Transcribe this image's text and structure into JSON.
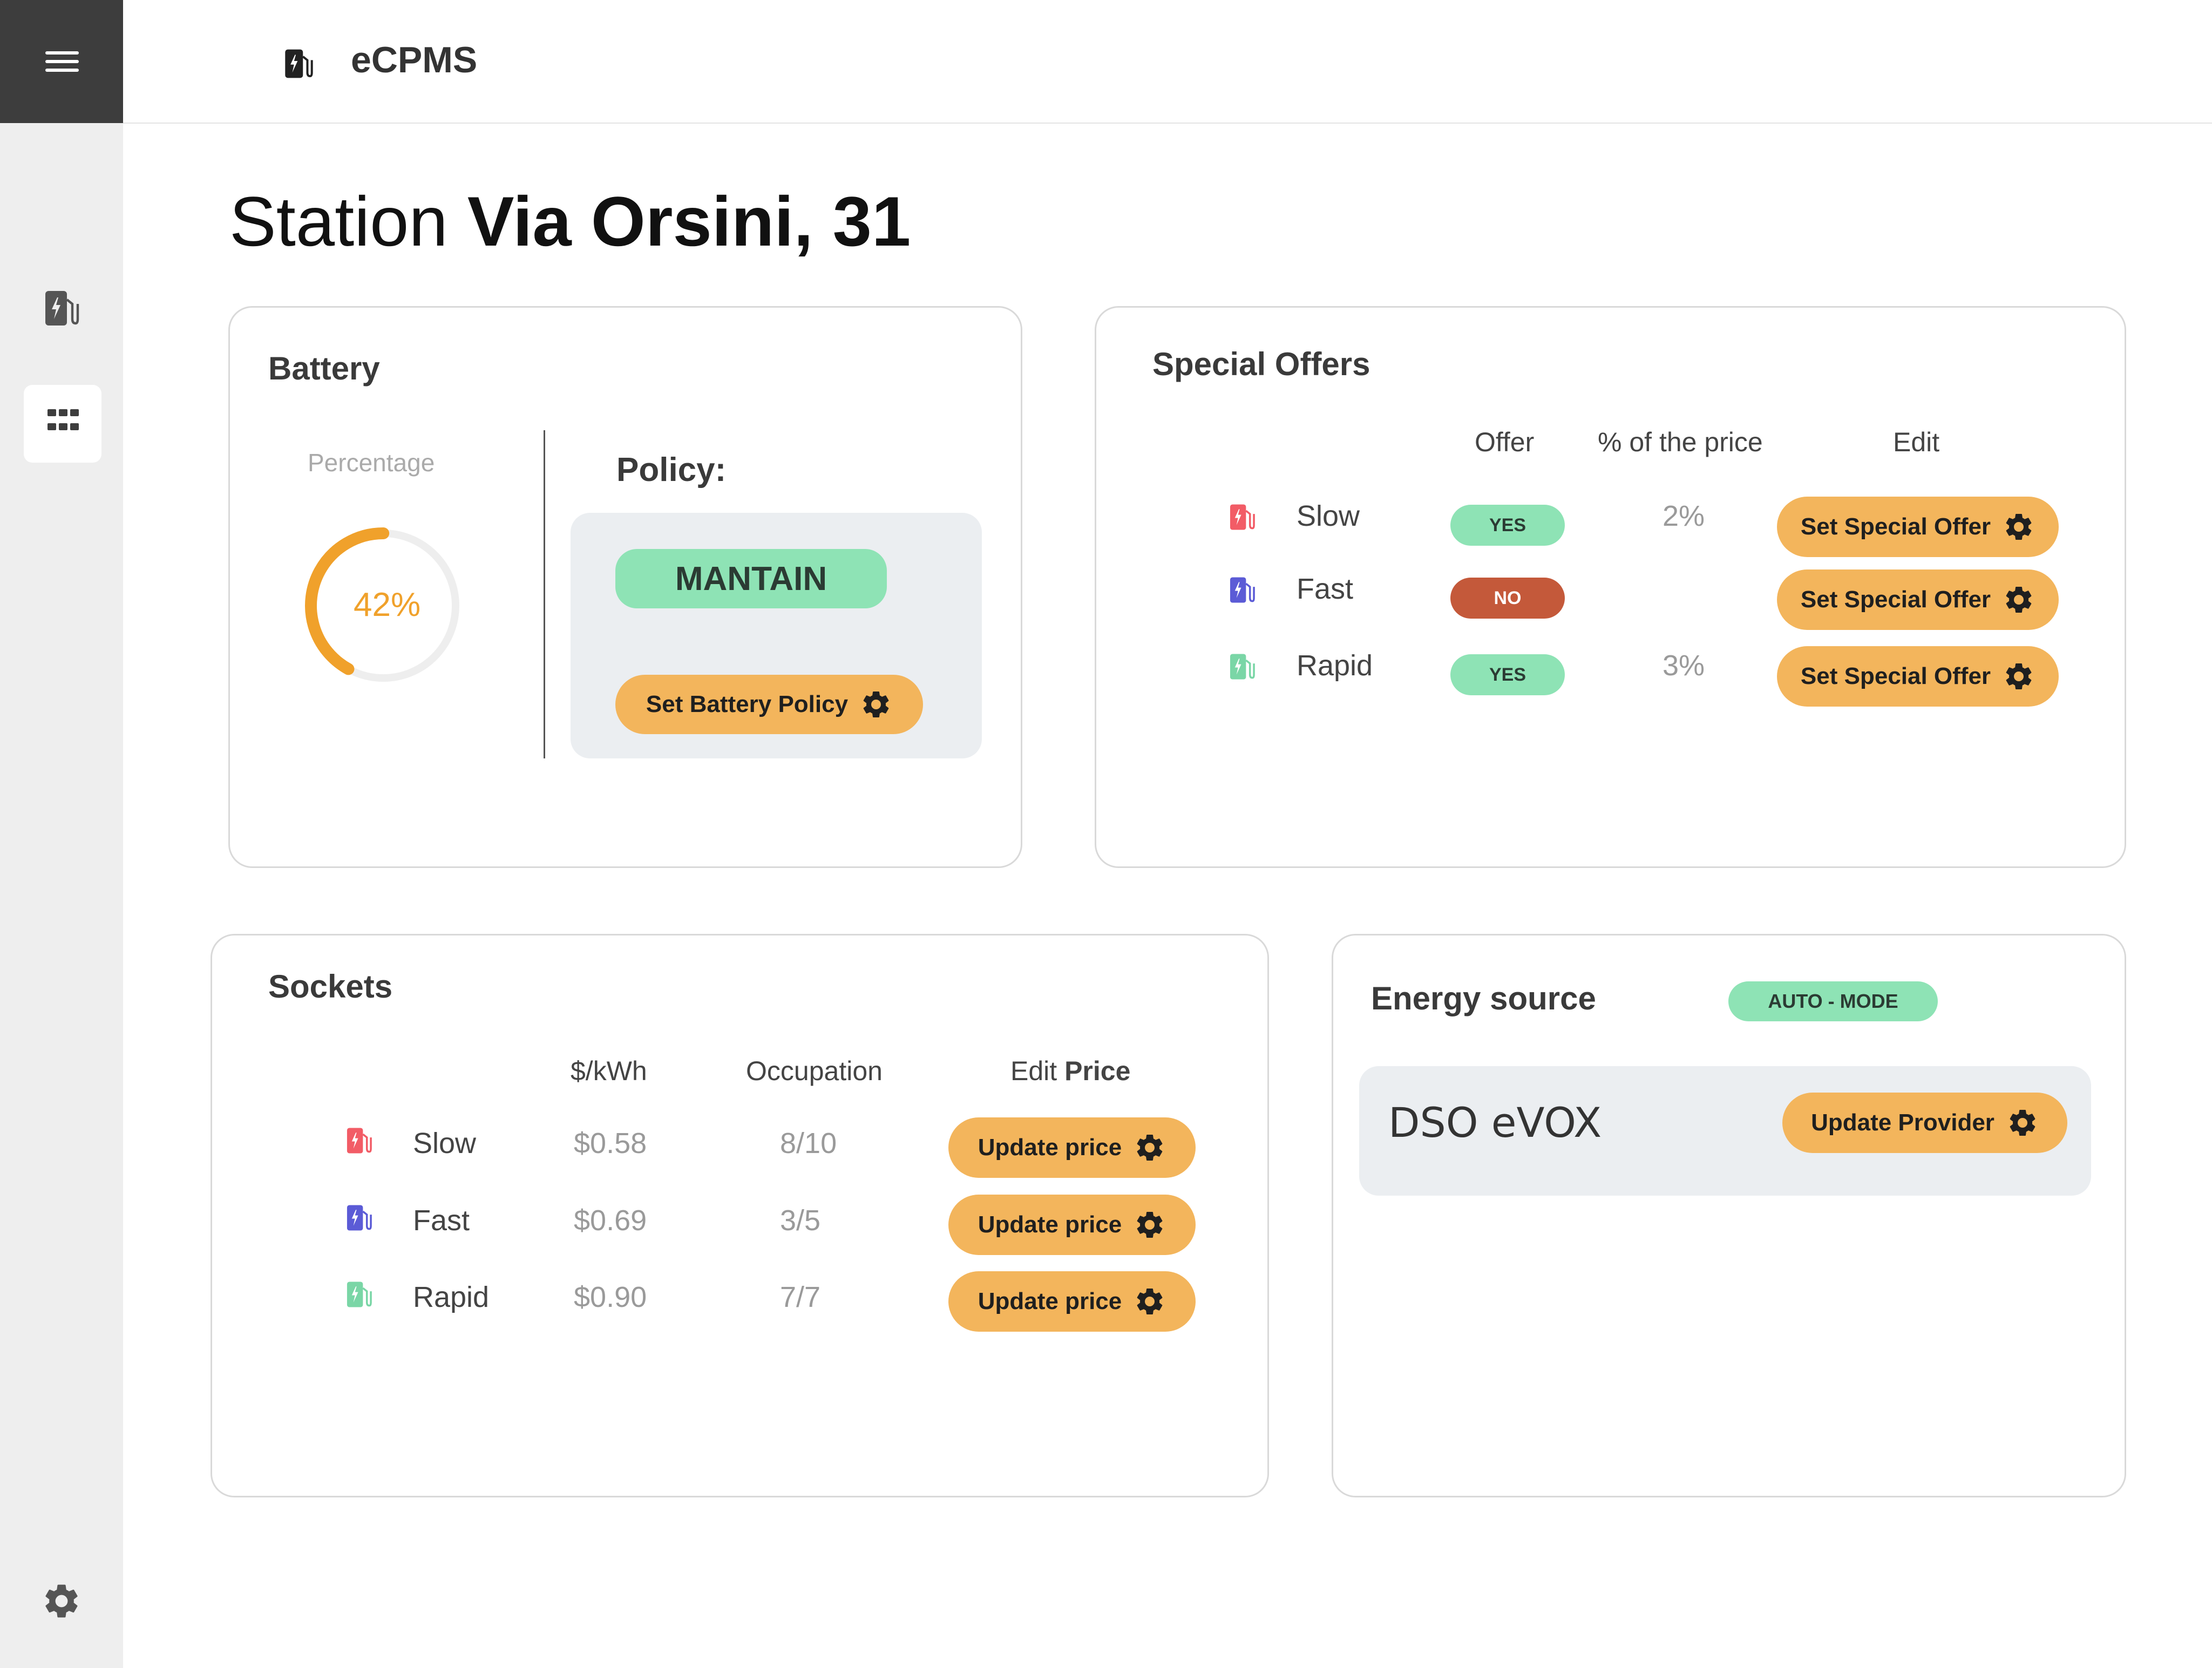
{
  "app": {
    "title": "eCPMS"
  },
  "page": {
    "prefix": "Station",
    "name": "Via Orsini, 31"
  },
  "battery": {
    "title": "Battery",
    "percentage_label": "Percentage",
    "value_text": "42%",
    "value": 0.42,
    "color": "#f0a12b",
    "policy_label": "Policy:",
    "policy": "MANTAIN",
    "button": "Set Battery Policy"
  },
  "offers": {
    "title": "Special Offers",
    "headers": {
      "offer": "Offer",
      "percent": "% of the price",
      "edit": "Edit"
    },
    "rows": [
      {
        "label": "Slow",
        "offer": "YES",
        "percent": "2%",
        "button": "Set Special Offer",
        "icon_color": "#f25c66"
      },
      {
        "label": "Fast",
        "offer": "NO",
        "percent": "",
        "button": "Set Special Offer",
        "icon_color": "#5b5bd6"
      },
      {
        "label": "Rapid",
        "offer": "YES",
        "percent": "3%",
        "button": "Set Special Offer",
        "icon_color": "#7ad6a6"
      }
    ]
  },
  "sockets": {
    "title": "Sockets",
    "headers": {
      "price": "$/kWh",
      "occupation": "Occupation",
      "edit": "Edit",
      "edit_bold": "Price"
    },
    "rows": [
      {
        "label": "Slow",
        "price": "$0.58",
        "occupation": "8/10",
        "button": "Update price"
      },
      {
        "label": "Fast",
        "price": "$0.69",
        "occupation": "3/5",
        "button": "Update price"
      },
      {
        "label": "Rapid",
        "price": "$0.90",
        "occupation": "7/7",
        "button": "Update price"
      }
    ]
  },
  "energy": {
    "title": "Energy source",
    "mode": "AUTO - MODE",
    "provider": "DSO eVOX",
    "button": "Update Provider"
  },
  "colors": {
    "accent": "#f3b55c",
    "green": "#8ee3b5",
    "red": "#c4593a",
    "sidebar_dark": "#3d3d3d"
  }
}
